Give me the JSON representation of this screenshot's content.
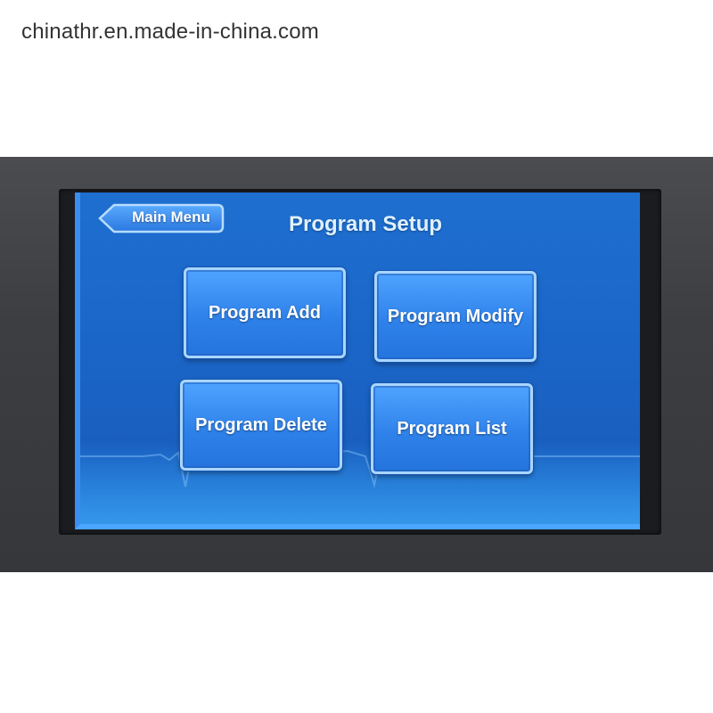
{
  "watermark": "chinathr.en.made-in-china.com",
  "screen": {
    "back_button_label": "Main Menu",
    "title": "Program Setup",
    "buttons": [
      {
        "label": "Program Add"
      },
      {
        "label": "Program Modify"
      },
      {
        "label": "Program Delete"
      },
      {
        "label": "Program List"
      }
    ]
  },
  "colors": {
    "screen_background": "#1a66c8",
    "button_fill": "#2f82ea",
    "button_border": "#a9d6ff",
    "bezel": "#3c3e42"
  }
}
